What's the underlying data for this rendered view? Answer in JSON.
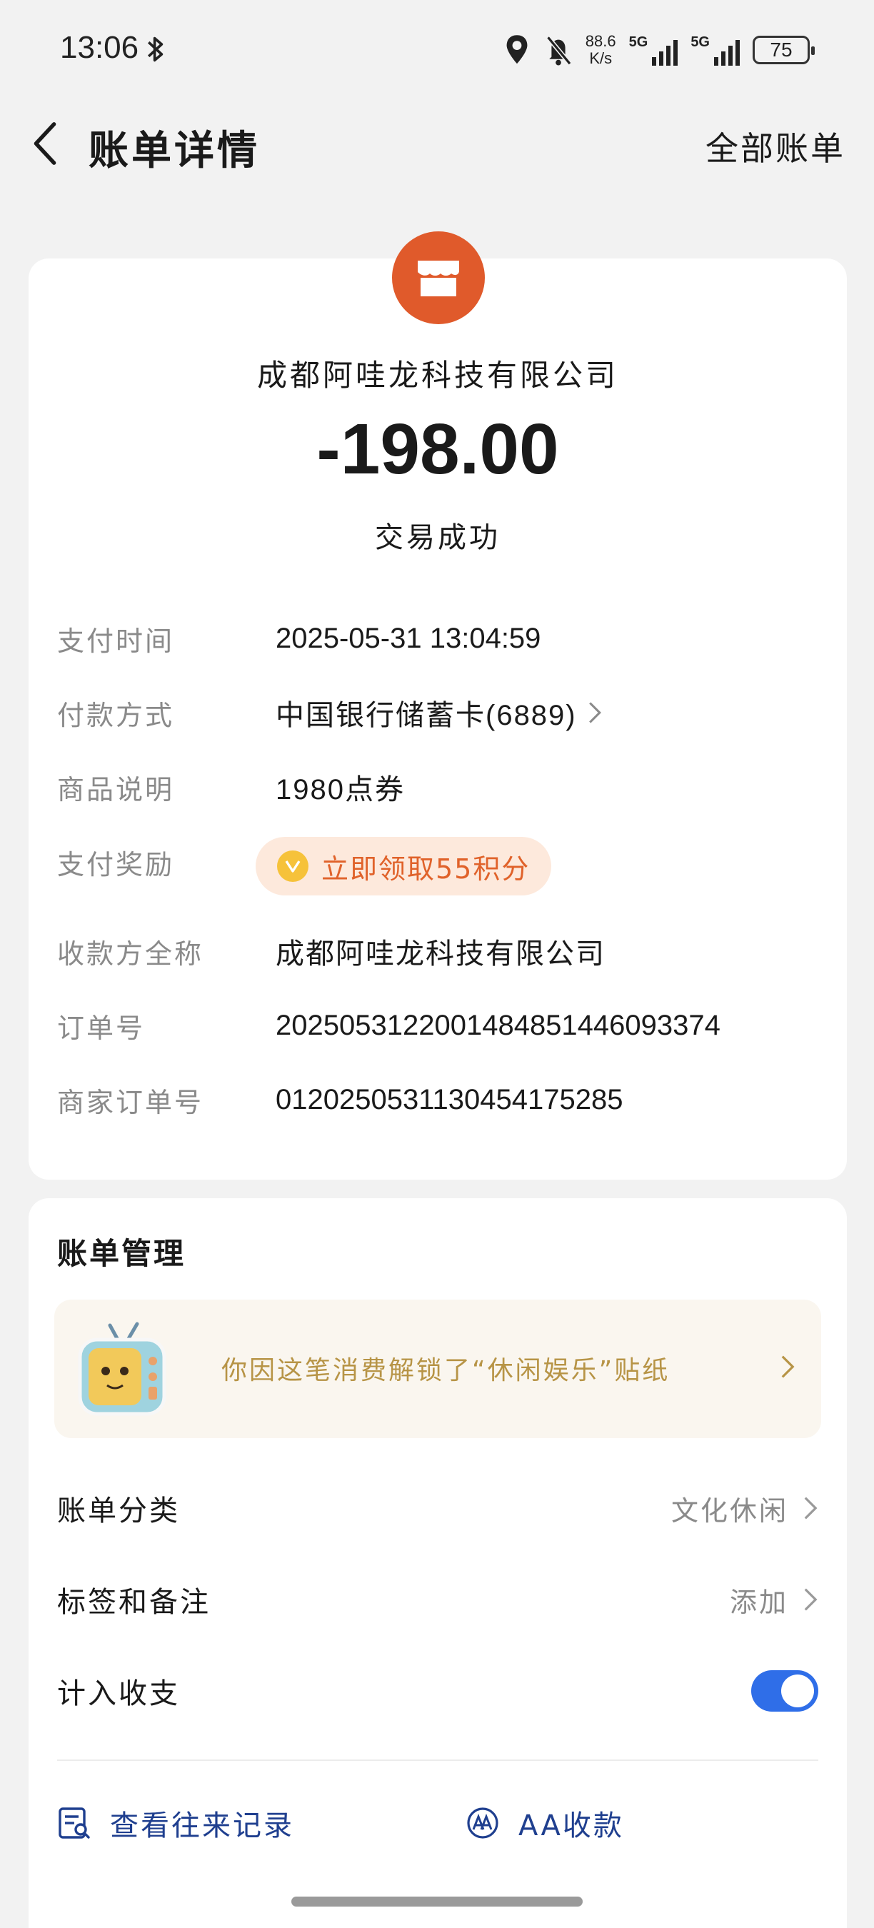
{
  "status_bar": {
    "time": "13:06",
    "net_speed_value": "88.6",
    "net_speed_unit": "K/s",
    "signal1_label": "5G",
    "signal2_label": "5G",
    "battery": "75"
  },
  "nav": {
    "title": "账单详情",
    "right_link": "全部账单"
  },
  "bill": {
    "merchant_name": "成都阿哇龙科技有限公司",
    "amount": "-198.00",
    "status": "交易成功",
    "rows": [
      {
        "label": "支付时间",
        "value": "2025-05-31 13:04:59"
      },
      {
        "label": "付款方式",
        "value": "中国银行储蓄卡(6889)"
      },
      {
        "label": "商品说明",
        "value": "1980点券"
      },
      {
        "label": "支付奖励",
        "value": "立即领取55积分"
      },
      {
        "label": "收款方全称",
        "value": "成都阿哇龙科技有限公司"
      },
      {
        "label": "订单号",
        "value": "2025053122001484851446093374"
      },
      {
        "label": "商家订单号",
        "value": "0120250531130454175285"
      }
    ]
  },
  "management": {
    "title": "账单管理",
    "sticker_text": "你因这笔消费解锁了“休闲娱乐”贴纸",
    "category_label": "账单分类",
    "category_value": "文化休闲",
    "tags_label": "标签和备注",
    "tags_value": "添加",
    "include_label": "计入收支",
    "include_enabled": true,
    "actions": {
      "history": "查看往来记录",
      "aa": "AA收款"
    }
  },
  "colors": {
    "accent_blue": "#2f6ee8",
    "merchant_orange": "#e05a2b",
    "reward_orange": "#e0622a",
    "action_blue": "#1f3f8f"
  }
}
